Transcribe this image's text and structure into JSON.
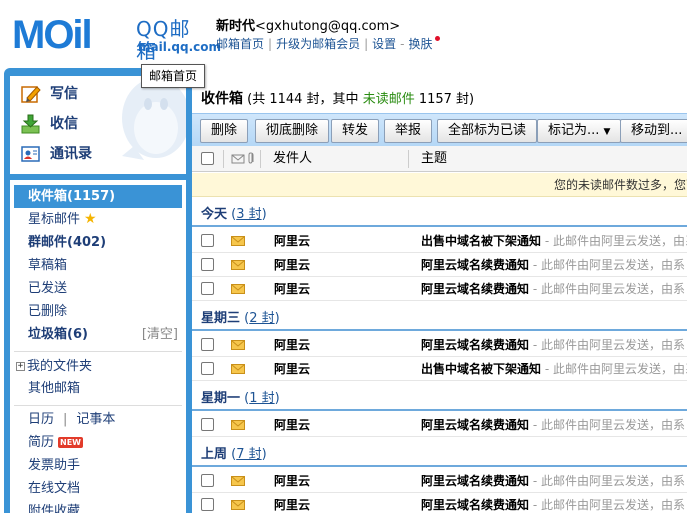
{
  "header": {
    "logo_text": "MOil",
    "logo_cn": "QQ邮箱",
    "logo_domain": "mail.qq.com",
    "nickname": "新时代",
    "email": "<gxhutong@qq.com>",
    "links": [
      "邮箱首页",
      "升级为邮箱会员",
      "设置",
      "换肤"
    ]
  },
  "tooltip": "邮箱首页",
  "quick_actions": [
    {
      "label": "写信",
      "icon": "compose-icon"
    },
    {
      "label": "收信",
      "icon": "inbox-download-icon"
    },
    {
      "label": "通讯录",
      "icon": "contacts-icon"
    }
  ],
  "folders": {
    "inbox": "收件箱(1157)",
    "starred": "星标邮件",
    "group": "群邮件(402)",
    "drafts": "草稿箱",
    "sent": "已发送",
    "deleted": "已删除",
    "spam": "垃圾箱(6)",
    "clear": "[清空]",
    "my_folders": "我的文件夹",
    "other_mail": "其他邮箱",
    "calendar": "日历",
    "calendar_sep": "|",
    "notepad": "记事本",
    "resume": "简历",
    "new_badge": "NEW",
    "invoice": "发票助手",
    "docs": "在线文档",
    "attachments": "附件收藏"
  },
  "inbox": {
    "title": "收件箱",
    "summary_a": " (共 1144 封，其中 ",
    "unread_label": "未读邮件",
    "summary_b": " 1157 封)"
  },
  "toolbar": {
    "delete": "删除",
    "perm_delete": "彻底删除",
    "forward": "转发",
    "report": "举报",
    "mark_all_read": "全部标为已读",
    "mark_as": "标记为...",
    "move_to": "移动到..."
  },
  "columns": {
    "sender": "发件人",
    "subject": "主题"
  },
  "notice": "您的未读邮件数过多，您可",
  "groups": [
    {
      "label": "今天",
      "count_open": " (",
      "count": "3 封",
      "count_close": ")",
      "rows": [
        {
          "sender": "阿里云",
          "subject": "出售中域名被下架通知",
          "preview": " - 此邮件由阿里云发送，由系"
        },
        {
          "sender": "阿里云",
          "subject": "阿里云域名续费通知",
          "preview": " - 此邮件由阿里云发送，由系"
        },
        {
          "sender": "阿里云",
          "subject": "阿里云域名续费通知",
          "preview": " - 此邮件由阿里云发送，由系"
        }
      ]
    },
    {
      "label": "星期三",
      "count_open": " (",
      "count": "2 封",
      "count_close": ")",
      "rows": [
        {
          "sender": "阿里云",
          "subject": "阿里云域名续费通知",
          "preview": " - 此邮件由阿里云发送，由系"
        },
        {
          "sender": "阿里云",
          "subject": "出售中域名被下架通知",
          "preview": " - 此邮件由阿里云发送，由系"
        }
      ]
    },
    {
      "label": "星期一",
      "count_open": " (",
      "count": "1 封",
      "count_close": ")",
      "rows": [
        {
          "sender": "阿里云",
          "subject": "阿里云域名续费通知",
          "preview": " - 此邮件由阿里云发送，由系"
        }
      ]
    },
    {
      "label": "上周",
      "count_open": " (",
      "count": "7 封",
      "count_close": ")",
      "rows": [
        {
          "sender": "阿里云",
          "subject": "阿里云域名续费通知",
          "preview": " - 此邮件由阿里云发送，由系"
        },
        {
          "sender": "阿里云",
          "subject": "阿里云域名续费通知",
          "preview": " - 此邮件由阿里云发送，由系"
        }
      ]
    }
  ]
}
